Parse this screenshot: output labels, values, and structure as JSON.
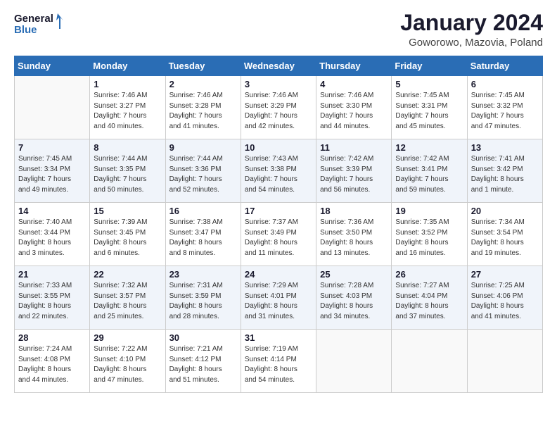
{
  "header": {
    "logo_line1": "General",
    "logo_line2": "Blue",
    "month": "January 2024",
    "location": "Goworowo, Mazovia, Poland"
  },
  "weekdays": [
    "Sunday",
    "Monday",
    "Tuesday",
    "Wednesday",
    "Thursday",
    "Friday",
    "Saturday"
  ],
  "weeks": [
    [
      {
        "day": "",
        "info": ""
      },
      {
        "day": "1",
        "info": "Sunrise: 7:46 AM\nSunset: 3:27 PM\nDaylight: 7 hours\nand 40 minutes."
      },
      {
        "day": "2",
        "info": "Sunrise: 7:46 AM\nSunset: 3:28 PM\nDaylight: 7 hours\nand 41 minutes."
      },
      {
        "day": "3",
        "info": "Sunrise: 7:46 AM\nSunset: 3:29 PM\nDaylight: 7 hours\nand 42 minutes."
      },
      {
        "day": "4",
        "info": "Sunrise: 7:46 AM\nSunset: 3:30 PM\nDaylight: 7 hours\nand 44 minutes."
      },
      {
        "day": "5",
        "info": "Sunrise: 7:45 AM\nSunset: 3:31 PM\nDaylight: 7 hours\nand 45 minutes."
      },
      {
        "day": "6",
        "info": "Sunrise: 7:45 AM\nSunset: 3:32 PM\nDaylight: 7 hours\nand 47 minutes."
      }
    ],
    [
      {
        "day": "7",
        "info": "Sunrise: 7:45 AM\nSunset: 3:34 PM\nDaylight: 7 hours\nand 49 minutes."
      },
      {
        "day": "8",
        "info": "Sunrise: 7:44 AM\nSunset: 3:35 PM\nDaylight: 7 hours\nand 50 minutes."
      },
      {
        "day": "9",
        "info": "Sunrise: 7:44 AM\nSunset: 3:36 PM\nDaylight: 7 hours\nand 52 minutes."
      },
      {
        "day": "10",
        "info": "Sunrise: 7:43 AM\nSunset: 3:38 PM\nDaylight: 7 hours\nand 54 minutes."
      },
      {
        "day": "11",
        "info": "Sunrise: 7:42 AM\nSunset: 3:39 PM\nDaylight: 7 hours\nand 56 minutes."
      },
      {
        "day": "12",
        "info": "Sunrise: 7:42 AM\nSunset: 3:41 PM\nDaylight: 7 hours\nand 59 minutes."
      },
      {
        "day": "13",
        "info": "Sunrise: 7:41 AM\nSunset: 3:42 PM\nDaylight: 8 hours\nand 1 minute."
      }
    ],
    [
      {
        "day": "14",
        "info": "Sunrise: 7:40 AM\nSunset: 3:44 PM\nDaylight: 8 hours\nand 3 minutes."
      },
      {
        "day": "15",
        "info": "Sunrise: 7:39 AM\nSunset: 3:45 PM\nDaylight: 8 hours\nand 6 minutes."
      },
      {
        "day": "16",
        "info": "Sunrise: 7:38 AM\nSunset: 3:47 PM\nDaylight: 8 hours\nand 8 minutes."
      },
      {
        "day": "17",
        "info": "Sunrise: 7:37 AM\nSunset: 3:49 PM\nDaylight: 8 hours\nand 11 minutes."
      },
      {
        "day": "18",
        "info": "Sunrise: 7:36 AM\nSunset: 3:50 PM\nDaylight: 8 hours\nand 13 minutes."
      },
      {
        "day": "19",
        "info": "Sunrise: 7:35 AM\nSunset: 3:52 PM\nDaylight: 8 hours\nand 16 minutes."
      },
      {
        "day": "20",
        "info": "Sunrise: 7:34 AM\nSunset: 3:54 PM\nDaylight: 8 hours\nand 19 minutes."
      }
    ],
    [
      {
        "day": "21",
        "info": "Sunrise: 7:33 AM\nSunset: 3:55 PM\nDaylight: 8 hours\nand 22 minutes."
      },
      {
        "day": "22",
        "info": "Sunrise: 7:32 AM\nSunset: 3:57 PM\nDaylight: 8 hours\nand 25 minutes."
      },
      {
        "day": "23",
        "info": "Sunrise: 7:31 AM\nSunset: 3:59 PM\nDaylight: 8 hours\nand 28 minutes."
      },
      {
        "day": "24",
        "info": "Sunrise: 7:29 AM\nSunset: 4:01 PM\nDaylight: 8 hours\nand 31 minutes."
      },
      {
        "day": "25",
        "info": "Sunrise: 7:28 AM\nSunset: 4:03 PM\nDaylight: 8 hours\nand 34 minutes."
      },
      {
        "day": "26",
        "info": "Sunrise: 7:27 AM\nSunset: 4:04 PM\nDaylight: 8 hours\nand 37 minutes."
      },
      {
        "day": "27",
        "info": "Sunrise: 7:25 AM\nSunset: 4:06 PM\nDaylight: 8 hours\nand 41 minutes."
      }
    ],
    [
      {
        "day": "28",
        "info": "Sunrise: 7:24 AM\nSunset: 4:08 PM\nDaylight: 8 hours\nand 44 minutes."
      },
      {
        "day": "29",
        "info": "Sunrise: 7:22 AM\nSunset: 4:10 PM\nDaylight: 8 hours\nand 47 minutes."
      },
      {
        "day": "30",
        "info": "Sunrise: 7:21 AM\nSunset: 4:12 PM\nDaylight: 8 hours\nand 51 minutes."
      },
      {
        "day": "31",
        "info": "Sunrise: 7:19 AM\nSunset: 4:14 PM\nDaylight: 8 hours\nand 54 minutes."
      },
      {
        "day": "",
        "info": ""
      },
      {
        "day": "",
        "info": ""
      },
      {
        "day": "",
        "info": ""
      }
    ]
  ]
}
